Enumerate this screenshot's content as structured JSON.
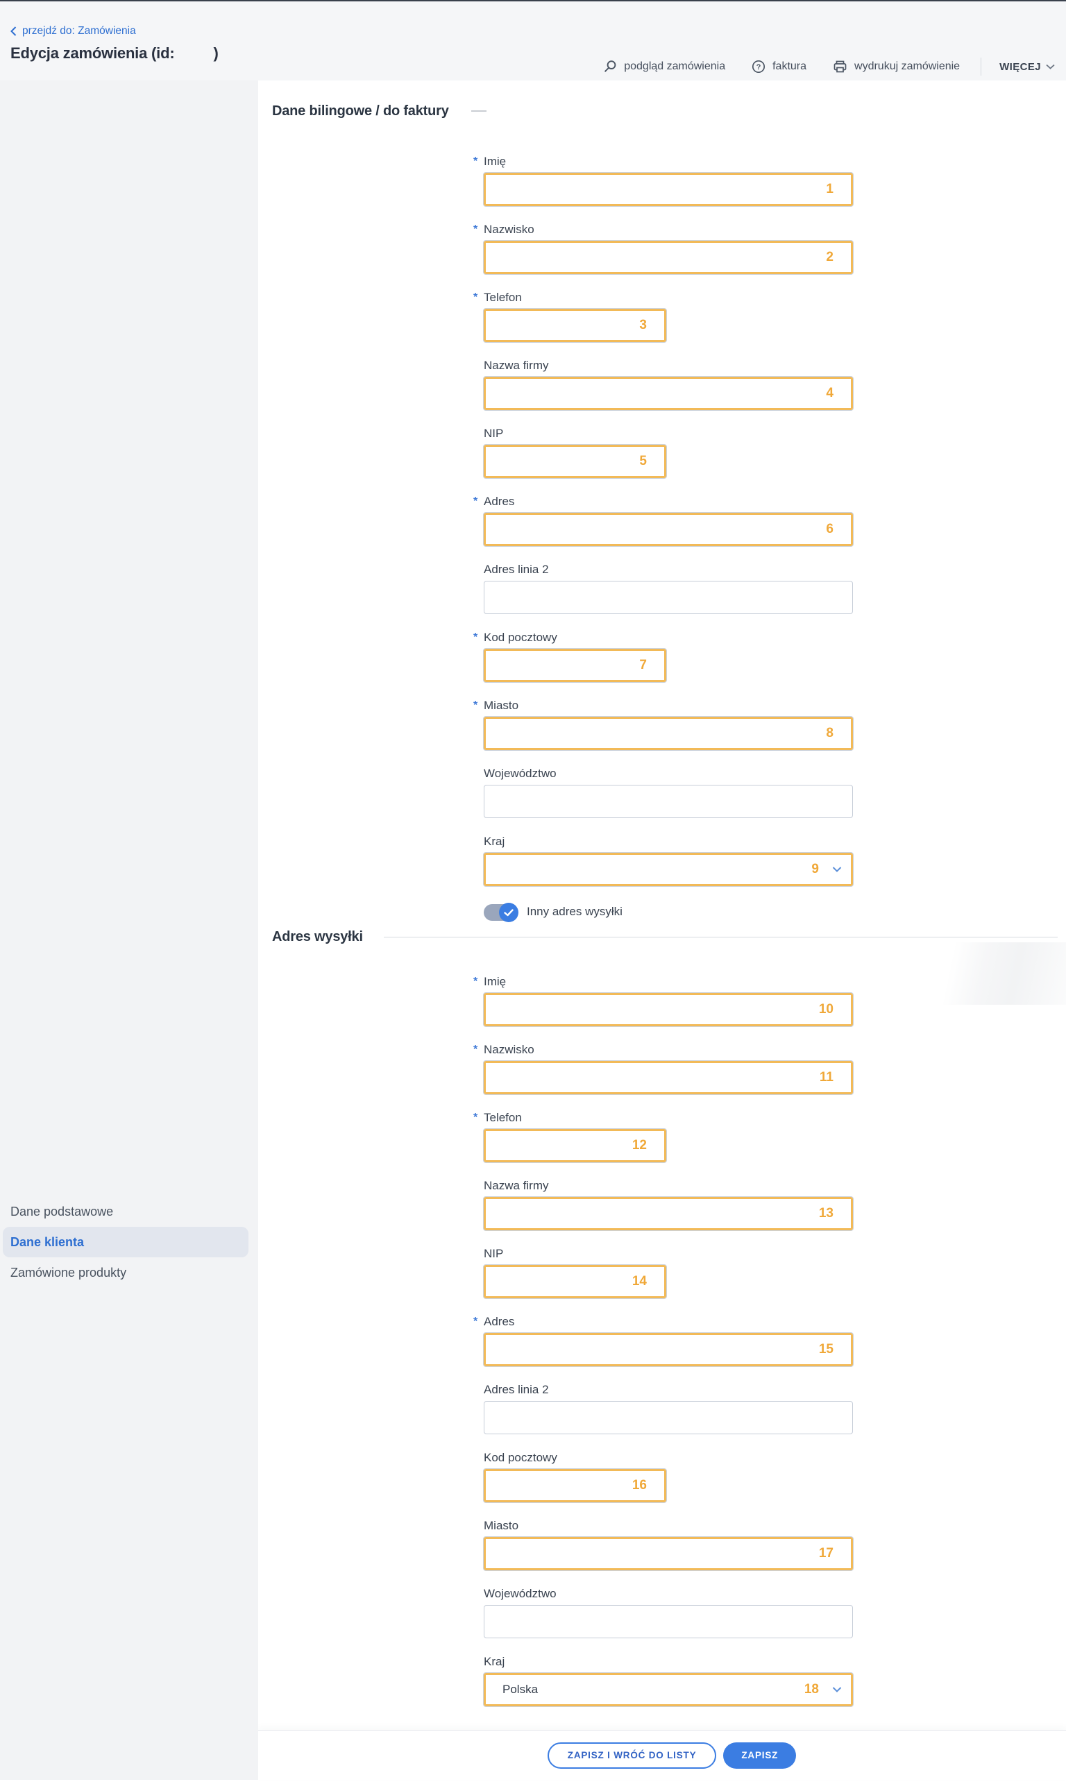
{
  "colors": {
    "accent_blue": "#2e6fd1",
    "button_blue": "#3b7de2",
    "annotation_border_orange": "#f2ba58",
    "annotation_number_orange": "#f0a838",
    "toggle_track_gray": "#9aa6bc",
    "sidebar_active_bg": "#e2e6ee",
    "header_bg": "#f5f6f8",
    "sidebar_bg": "#f2f3f5"
  },
  "header": {
    "breadcrumb_label": "przejdź do: Zamówienia",
    "title_prefix": "Edycja zamówienia (id:",
    "title_suffix": ")",
    "actions": [
      {
        "key": "preview-order",
        "label": "podgląd zamówienia",
        "icon": "magnifier-icon"
      },
      {
        "key": "invoice",
        "label": "faktura",
        "icon": "question-circle-icon"
      },
      {
        "key": "print-order",
        "label": "wydrukuj zamówienie",
        "icon": "printer-icon"
      },
      {
        "key": "more",
        "label": "WIĘCEJ",
        "icon": "chevron-down-icon"
      }
    ]
  },
  "sidebar": {
    "items": [
      {
        "key": "basic-data",
        "label": "Dane podstawowe",
        "active": false
      },
      {
        "key": "customer-data",
        "label": "Dane klienta",
        "active": true
      },
      {
        "key": "ordered-products",
        "label": "Zamówione produkty",
        "active": false
      }
    ]
  },
  "sections": [
    {
      "key": "billing",
      "title": "Dane bilingowe / do faktury",
      "fields": [
        {
          "key": "first-name",
          "label": "Imię",
          "required": true,
          "num": "1",
          "size": "full",
          "control": "input",
          "value": ""
        },
        {
          "key": "last-name",
          "label": "Nazwisko",
          "required": true,
          "num": "2",
          "size": "full",
          "control": "input",
          "value": ""
        },
        {
          "key": "phone",
          "label": "Telefon",
          "required": true,
          "num": "3",
          "size": "short",
          "control": "input",
          "value": ""
        },
        {
          "key": "company-name",
          "label": "Nazwa firmy",
          "required": false,
          "num": "4",
          "size": "full",
          "control": "input",
          "value": ""
        },
        {
          "key": "tax-id",
          "label": "NIP",
          "required": false,
          "num": "5",
          "size": "short",
          "control": "input",
          "value": ""
        },
        {
          "key": "address",
          "label": "Adres",
          "required": true,
          "num": "6",
          "size": "full",
          "control": "input",
          "value": ""
        },
        {
          "key": "address-line-2",
          "label": "Adres linia 2",
          "required": false,
          "num": "",
          "size": "full",
          "control": "input",
          "value": ""
        },
        {
          "key": "postal-code",
          "label": "Kod pocztowy",
          "required": true,
          "num": "7",
          "size": "short",
          "control": "input",
          "value": ""
        },
        {
          "key": "city",
          "label": "Miasto",
          "required": true,
          "num": "8",
          "size": "full",
          "control": "input",
          "value": ""
        },
        {
          "key": "province",
          "label": "Województwo",
          "required": false,
          "num": "",
          "size": "full",
          "control": "input",
          "value": ""
        },
        {
          "key": "country",
          "label": "Kraj",
          "required": false,
          "num": "9",
          "size": "full",
          "control": "select",
          "value": ""
        }
      ]
    },
    {
      "key": "shipping",
      "title": "Adres wysyłki",
      "fields": [
        {
          "key": "first-name",
          "label": "Imię",
          "required": true,
          "num": "10",
          "size": "full",
          "control": "input",
          "value": ""
        },
        {
          "key": "last-name",
          "label": "Nazwisko",
          "required": true,
          "num": "11",
          "size": "full",
          "control": "input",
          "value": ""
        },
        {
          "key": "phone",
          "label": "Telefon",
          "required": true,
          "num": "12",
          "size": "short",
          "control": "input",
          "value": ""
        },
        {
          "key": "company-name",
          "label": "Nazwa firmy",
          "required": false,
          "num": "13",
          "size": "full",
          "control": "input",
          "value": ""
        },
        {
          "key": "tax-id",
          "label": "NIP",
          "required": false,
          "num": "14",
          "size": "short",
          "control": "input",
          "value": ""
        },
        {
          "key": "address",
          "label": "Adres",
          "required": true,
          "num": "15",
          "size": "full",
          "control": "input",
          "value": ""
        },
        {
          "key": "address-line-2",
          "label": "Adres linia 2",
          "required": false,
          "num": "",
          "size": "full",
          "control": "input",
          "value": ""
        },
        {
          "key": "postal-code",
          "label": "Kod pocztowy",
          "required": false,
          "num": "16",
          "size": "short",
          "control": "input",
          "value": ""
        },
        {
          "key": "city",
          "label": "Miasto",
          "required": false,
          "num": "17",
          "size": "full",
          "control": "input",
          "value": ""
        },
        {
          "key": "province",
          "label": "Województwo",
          "required": false,
          "num": "",
          "size": "full",
          "control": "input",
          "value": ""
        },
        {
          "key": "country",
          "label": "Kraj",
          "required": false,
          "num": "18",
          "size": "full",
          "control": "select",
          "value": "Polska"
        }
      ]
    }
  ],
  "toggle": {
    "label": "Inny adres wysyłki",
    "state": "on"
  },
  "footer": {
    "buttons": [
      {
        "key": "save-and-return",
        "label": "ZAPISZ I WRÓĆ DO LISTY",
        "variant": "outline"
      },
      {
        "key": "save",
        "label": "ZAPISZ",
        "variant": "solid"
      }
    ]
  }
}
